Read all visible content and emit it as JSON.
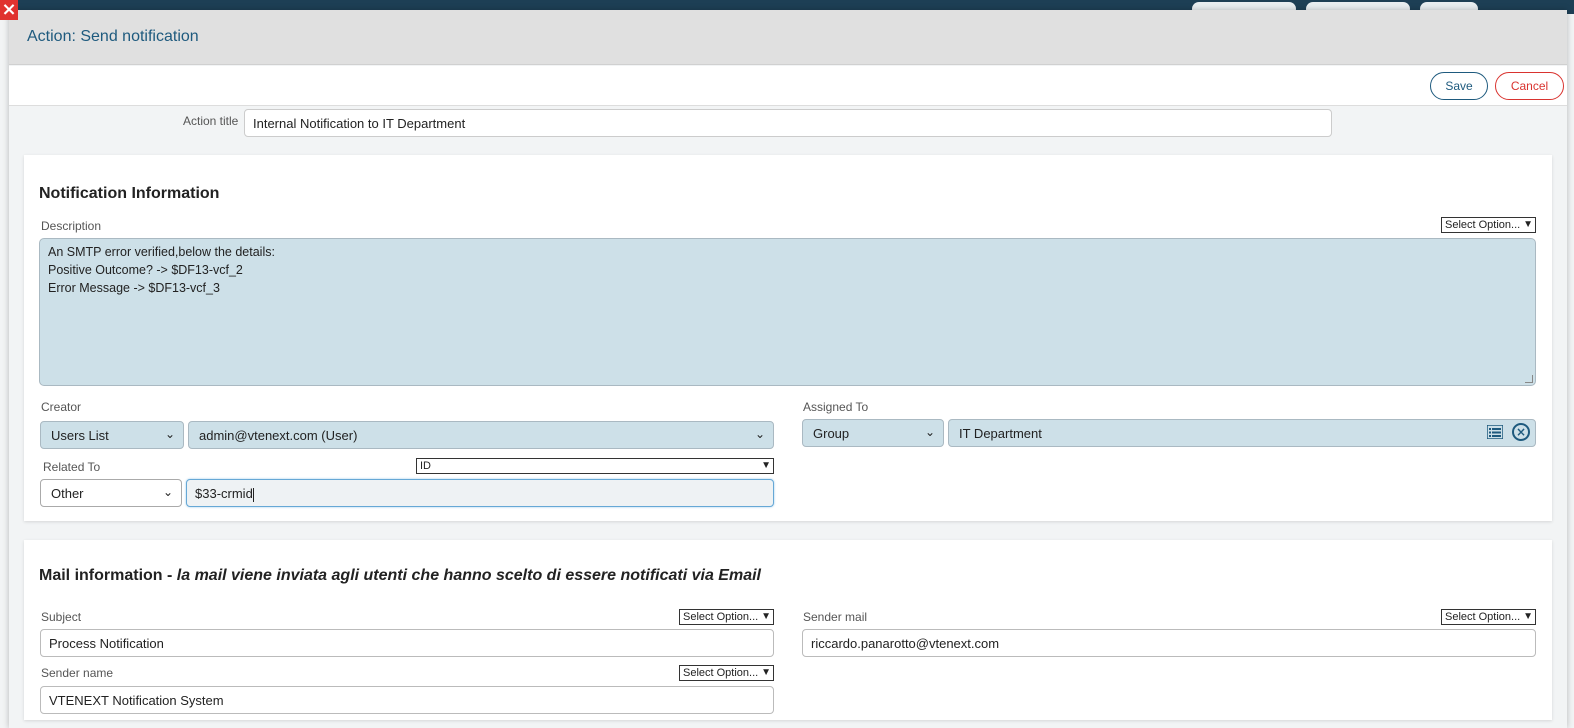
{
  "modal": {
    "title": "Action: Send notification",
    "save_label": "Save",
    "cancel_label": "Cancel"
  },
  "action_title": {
    "label": "Action title",
    "value": "Internal Notification to IT Department"
  },
  "notification": {
    "section_title": "Notification Information",
    "description_label": "Description",
    "description_option": "Select Option...",
    "description_lines": [
      "An SMTP error verified,below the details:",
      "Positive Outcome? -> $DF13-vcf_2",
      "Error Message -> $DF13-vcf_3"
    ],
    "creator_label": "Creator",
    "creator_type": "Users List",
    "creator_value": "admin@vtenext.com (User)",
    "assigned_label": "Assigned To",
    "assigned_type": "Group",
    "assigned_value": "IT Department",
    "related_label": "Related To",
    "related_field": "ID",
    "related_type": "Other",
    "related_value": "$33-crmid"
  },
  "mail": {
    "section_title_prefix": "Mail information - ",
    "section_title_note": "la mail viene inviata agli utenti che hanno scelto di essere notificati via Email",
    "subject_label": "Subject",
    "subject_option": "Select Option...",
    "subject_value": "Process Notification",
    "sender_mail_label": "Sender mail",
    "sender_mail_option": "Select Option...",
    "sender_mail_value": "riccardo.panarotto@vtenext.com",
    "sender_name_label": "Sender name",
    "sender_name_option": "Select Option...",
    "sender_name_value": "VTENEXT Notification System"
  },
  "colors": {
    "accent": "#1e5a7e",
    "danger": "#d9332f",
    "field_bg": "#cde0e8"
  }
}
